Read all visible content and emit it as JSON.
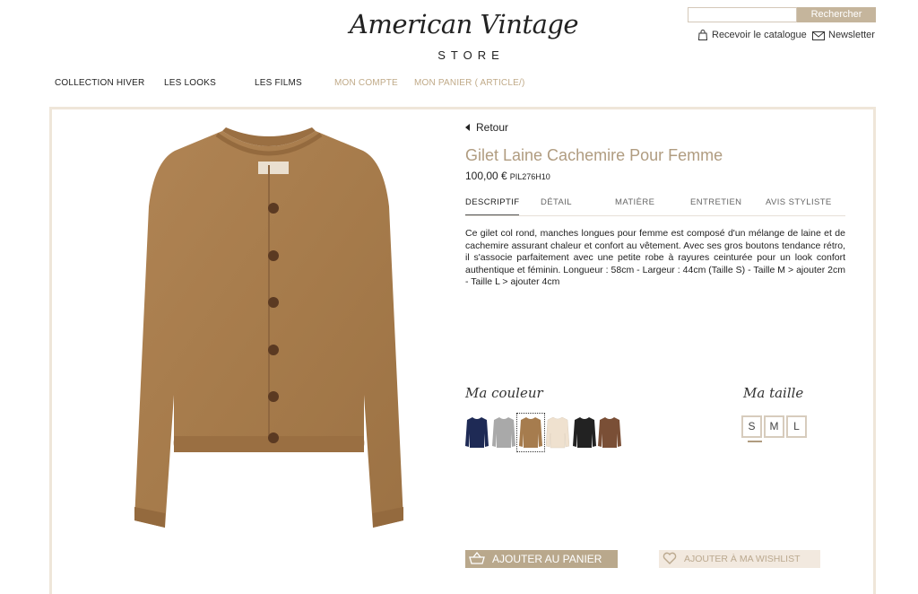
{
  "header": {
    "logo_script": "American Vintage",
    "logo_store": "STORE",
    "search": {
      "placeholder": "",
      "button_label": "Rechercher"
    },
    "catalog_link": "Recevoir le catalogue",
    "newsletter_link": "Newsletter"
  },
  "nav": [
    {
      "label": "COLLECTION HIVER"
    },
    {
      "label": "LES LOOKS"
    },
    {
      "label": "LES FILMS"
    },
    {
      "label": "MON COMPTE"
    },
    {
      "label": "MON PANIER ( ARTICLE/)"
    }
  ],
  "product": {
    "back_label": "Retour",
    "title": "Gilet Laine Cachemire Pour Femme",
    "price": "100,00 €",
    "reference": "PIL276H10",
    "tabs": [
      {
        "label": "DESCRIPTIF"
      },
      {
        "label": "DÉTAIL"
      },
      {
        "label": "MATIÈRE"
      },
      {
        "label": "ENTRETIEN"
      },
      {
        "label": "AVIS STYLISTE"
      }
    ],
    "description": "Ce gilet col rond, manches longues pour femme est composé d'un mélange de laine et de cachemire assurant chaleur et confort au vêtement. Avec ses gros boutons tendance rétro, il s'associe parfaitement avec une petite robe à rayures ceinturée pour un look confort authentique et féminin. Longueur : 58cm - Largeur : 44cm (Taille S) - Taille M > ajouter 2cm - Taille L > ajouter 4cm",
    "color_label": "Ma couleur",
    "size_label": "Ma taille",
    "colors": [
      {
        "name": "navy",
        "hex": "#1e2a55"
      },
      {
        "name": "grey",
        "hex": "#a9a9a9"
      },
      {
        "name": "camel",
        "hex": "#a67c4e"
      },
      {
        "name": "ivory",
        "hex": "#efe1cf"
      },
      {
        "name": "black",
        "hex": "#222222"
      },
      {
        "name": "brown",
        "hex": "#7a4f36"
      }
    ],
    "selected_color": "camel",
    "sizes": [
      "S",
      "M",
      "L"
    ],
    "add_to_cart": "AJOUTER AU PANIER",
    "add_to_wishlist": "AJOUTER À MA WISHLIST"
  },
  "colors": {
    "accent": "#c5b59c",
    "title": "#b09c80",
    "frame": "#efe6d9",
    "nav_light": "#c0aa88"
  }
}
